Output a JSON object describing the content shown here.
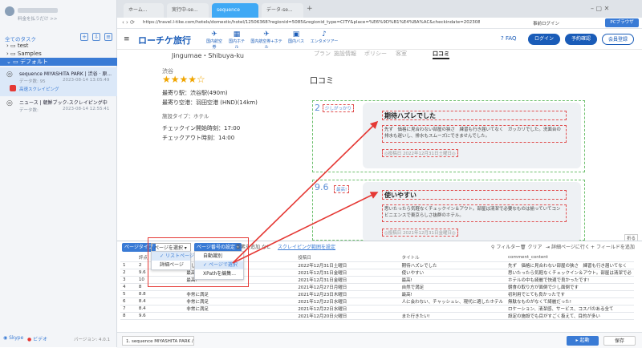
{
  "sidebar": {
    "upgrade_label": "料金を払うだけ >>",
    "all_tasks": "全てのタスク",
    "tree": [
      {
        "label": "test"
      },
      {
        "label": "Samples"
      },
      {
        "label": "デフォルト"
      }
    ],
    "tasks": [
      {
        "title": "sequence MIYASHITA PARK | 渋谷 · 原...",
        "meta_label": "データ数:",
        "count": "95",
        "date": "2023-08-14 13:05:49",
        "status": "高速スクレイピング"
      },
      {
        "title": "ニュース | 朝鮮ブック-スクレイピング中",
        "meta_label": "データ数:",
        "count": "",
        "date": "2023-08-14 12:55:41",
        "status": ""
      }
    ],
    "footer": {
      "skype": "Skype",
      "video": "ビデオ",
      "version": "バージョン: 4.0.1"
    }
  },
  "browser": {
    "tabs": [
      "ホーム...",
      "実行中-se...",
      "sequence",
      "データ-se..."
    ],
    "add_tab": "+",
    "url": "https://travel.l-tike.com/hotels/domestic/hotel/12506368?regionid=5085&regionid_type=CITY&place=%E6%9D%B1%E4%BA%AC&checkindate=20230816&check...",
    "right_buttons": [
      "事前ログイン",
      "PCブラウザ"
    ]
  },
  "site": {
    "logo": "ローチケ旅行",
    "nav": [
      "国内航空券",
      "国内ホテル",
      "国内航空券+ホテル",
      "国内バス",
      "エンタメツアー"
    ],
    "faq": "FAQ",
    "login": "ログイン",
    "reservation": "予約確認",
    "register": "会員登録"
  },
  "hotel": {
    "area": "Jingumae・Shibuya-ku",
    "tabs": [
      "プラン",
      "施設情報",
      "ポリシー",
      "客室",
      "口コミ"
    ],
    "region": "渋谷",
    "stars": "★★★★☆",
    "station": "最寄り駅：渋谷駅(490m)",
    "airport": "最寄り空港：羽田空港 (HND)(14km)",
    "facility_type": "施設タイプ：ホテル",
    "checkin": "チェックイン開始時刻：17:00",
    "checkout": "チェックアウト時刻：14:00",
    "reviews_heading": "口コミ",
    "reviews": [
      {
        "score": "2",
        "score_label": "少しがっかり",
        "title": "期待ハズレでした",
        "body": "先ず　価格に見合わない部屋の狭さ　練習も行き届いてなく　ガッカリでした。洗面台の排水も遅いし、排水もスムーズにできませんでした。",
        "date": "◎投稿日 2022年12月31日土曜日◎"
      },
      {
        "score": "9.6",
        "score_label": "最高!",
        "title": "使いやすい",
        "body": "思いたったら気軽なくチェックイン＆アウト。部屋は清潔で必要なものは揃っていてコンビニエンスで東京らしさ抜群のホテル。",
        "date": "◎投稿日 2021年12月31日金曜日◎"
      }
    ],
    "fold": "折る"
  },
  "panel": {
    "page_type": "ページタイプ",
    "select_page": "ページを選択",
    "set_page_count": "ページ番号の設定",
    "add_field": "要素を追加",
    "etc": "など",
    "scrape_range": "スクレイピング範囲を設定",
    "filter": "フィルター",
    "clear": "クリア",
    "jump_page": "詳細ページに行く",
    "add_field_right": "フィールドを追加",
    "menu1": [
      "リストページ",
      "詳細ページ"
    ],
    "menu2": [
      "自動識別",
      "ページで選択",
      "XPathを編集..."
    ],
    "columns": [
      "評点",
      "",
      "投稿日",
      "タイトル",
      "comment_content"
    ],
    "rows": [
      [
        "2",
        "少しがっかり",
        "2022年12月31日土曜日",
        "期待ハズレでした",
        "先ず　価格に見合わない部屋の狭さ　練習も行き届いてなく"
      ],
      [
        "9.6",
        "最高!",
        "2021年12月31日金曜日",
        "使いやすい",
        "思いたったら気軽なくチェックイン＆アウト。部屋は清潔で必"
      ],
      [
        "10",
        "最高!",
        "2021年12月31日金曜日",
        "最高!",
        "ホテルの中も綺麗で快適で良かったです!"
      ],
      [
        "8",
        "",
        "2021年12月27日月曜日",
        "自然で満足",
        "朝食の取り方が面倒で少し面倒です"
      ],
      [
        "8.8",
        "非常に満足",
        "2021年12月23日木曜日",
        "最高!",
        "初利用でとても良かったです"
      ],
      [
        "8.4",
        "非常に満足",
        "2021年12月22日水曜日",
        "人に会わない、チャッシュレ、現代に適したホテル",
        "無駄なものがなくて綺麗だった!"
      ],
      [
        "8.4",
        "非常に満足",
        "2021年12月22日水曜日",
        "",
        "ロケーション、清潔感、サービス、コスパのある全て"
      ],
      [
        "9.6",
        "",
        "2021年12月20日火曜日",
        "また行きたい!",
        "設定の施設でも目がすごく扱えて、目的が多い"
      ]
    ],
    "task_tab": "1. sequence MIYASHITA PARK /...",
    "start": "起動",
    "save": "保存"
  },
  "colors": {
    "accent": "#3a7bd5",
    "brand": "#1a5cb8",
    "tab_active": "#3fa9f5",
    "annotation": "#e53935"
  }
}
